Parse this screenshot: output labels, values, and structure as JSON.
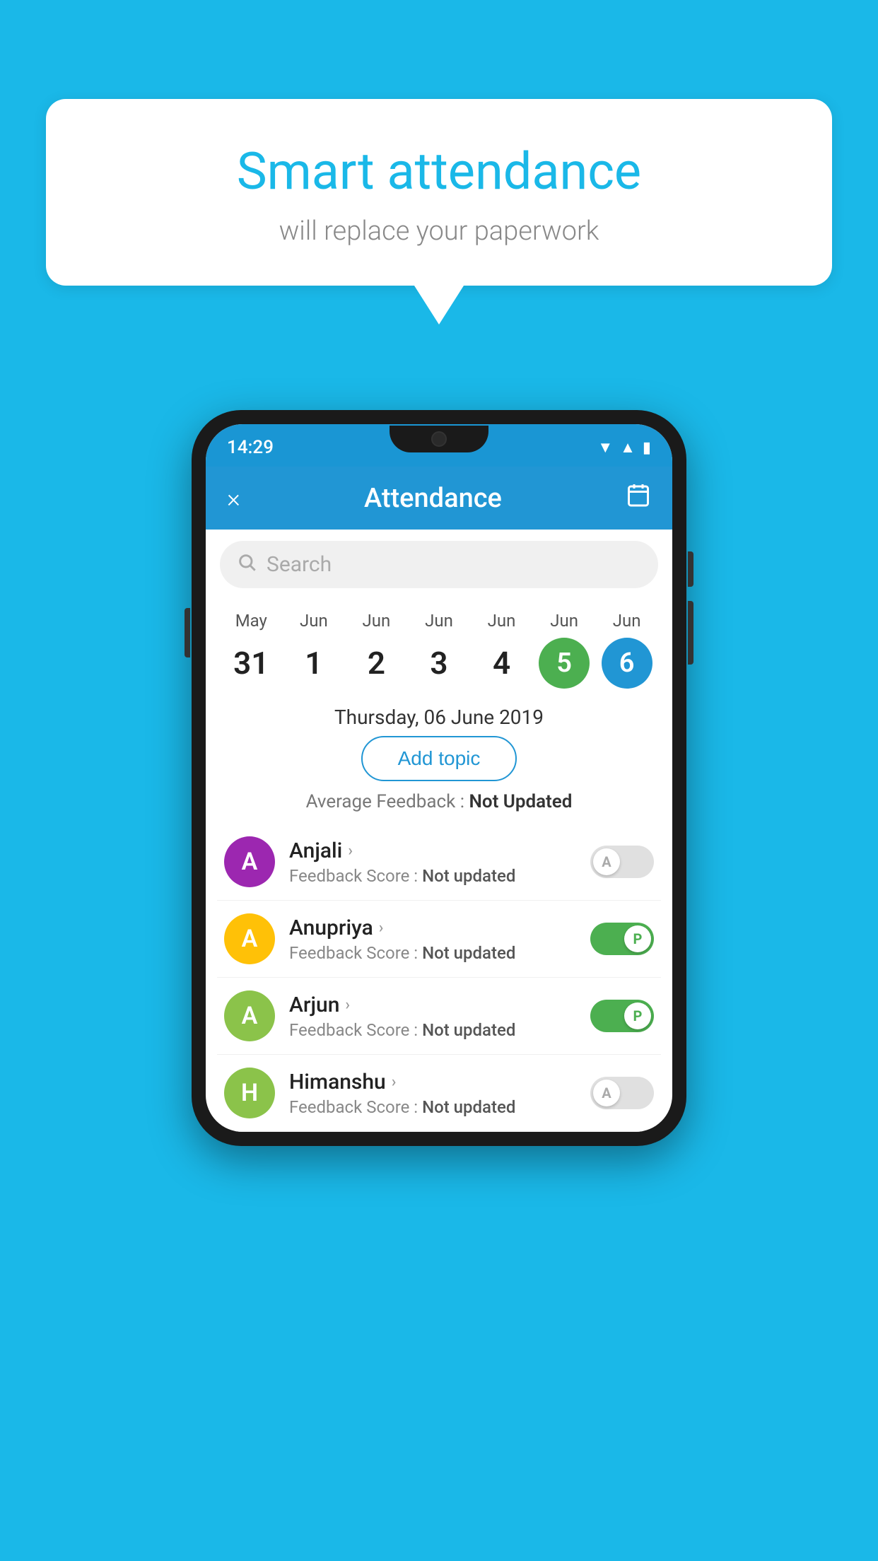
{
  "background_color": "#1ab8e8",
  "speech_bubble": {
    "title": "Smart attendance",
    "subtitle": "will replace your paperwork"
  },
  "phone": {
    "status_bar": {
      "time": "14:29"
    },
    "header": {
      "close_label": "×",
      "title": "Attendance",
      "calendar_icon": "📅"
    },
    "search": {
      "placeholder": "Search"
    },
    "dates": [
      {
        "month": "May",
        "day": "31",
        "style": "normal"
      },
      {
        "month": "Jun",
        "day": "1",
        "style": "normal"
      },
      {
        "month": "Jun",
        "day": "2",
        "style": "normal"
      },
      {
        "month": "Jun",
        "day": "3",
        "style": "normal"
      },
      {
        "month": "Jun",
        "day": "4",
        "style": "normal"
      },
      {
        "month": "Jun",
        "day": "5",
        "style": "today"
      },
      {
        "month": "Jun",
        "day": "6",
        "style": "selected"
      }
    ],
    "selected_date": "Thursday, 06 June 2019",
    "add_topic_label": "Add topic",
    "average_feedback": {
      "label": "Average Feedback : ",
      "value": "Not Updated"
    },
    "students": [
      {
        "name": "Anjali",
        "avatar_letter": "A",
        "avatar_color": "#9c27b0",
        "feedback_label": "Feedback Score : ",
        "feedback_value": "Not updated",
        "attendance": "absent",
        "toggle_letter": "A"
      },
      {
        "name": "Anupriya",
        "avatar_letter": "A",
        "avatar_color": "#ffc107",
        "feedback_label": "Feedback Score : ",
        "feedback_value": "Not updated",
        "attendance": "present",
        "toggle_letter": "P"
      },
      {
        "name": "Arjun",
        "avatar_letter": "A",
        "avatar_color": "#8bc34a",
        "feedback_label": "Feedback Score : ",
        "feedback_value": "Not updated",
        "attendance": "present",
        "toggle_letter": "P"
      },
      {
        "name": "Himanshu",
        "avatar_letter": "H",
        "avatar_color": "#8bc34a",
        "feedback_label": "Feedback Score : ",
        "feedback_value": "Not updated",
        "attendance": "absent",
        "toggle_letter": "A"
      }
    ]
  }
}
